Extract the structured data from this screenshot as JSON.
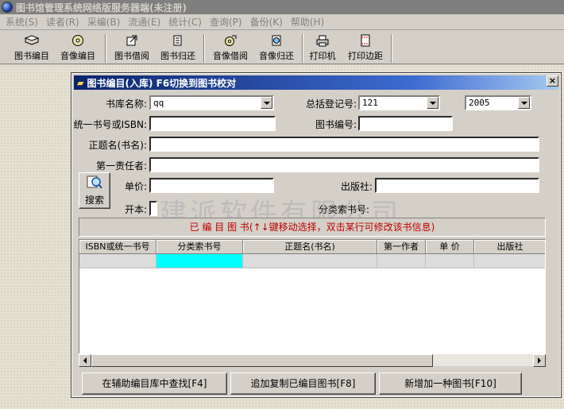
{
  "app": {
    "title": "图书馆管理系统网络版服务器端(未注册)"
  },
  "menu": [
    {
      "label": "系统(S)"
    },
    {
      "label": "读者(R)"
    },
    {
      "label": "采编(B)"
    },
    {
      "label": "流通(E)"
    },
    {
      "label": "统计(C)"
    },
    {
      "label": "查询(P)"
    },
    {
      "label": "备份(K)"
    },
    {
      "label": "帮助(H)"
    }
  ],
  "toolbar": {
    "buttons": [
      {
        "label": "图书编目",
        "icon": "book-icon"
      },
      {
        "label": "音像编目",
        "icon": "disc-icon"
      },
      {
        "label": "图书借阅",
        "icon": "book-borrow-icon"
      },
      {
        "label": "图书归还",
        "icon": "book-return-icon"
      },
      {
        "label": "音像借阅",
        "icon": "disc-borrow-icon"
      },
      {
        "label": "音像归还",
        "icon": "disc-return-icon"
      },
      {
        "label": "打印机",
        "icon": "printer-icon"
      },
      {
        "label": "打印边距",
        "icon": "print-margin-icon"
      }
    ]
  },
  "dialog": {
    "title": "图书编目(入库) F6切换到图书校对",
    "close_label": "×",
    "fields": {
      "library_name": {
        "label": "书库名称:",
        "value": "qq"
      },
      "register_no": {
        "label": "总括登记号:",
        "value": "121"
      },
      "year": {
        "value": "2005"
      },
      "isbn": {
        "label": "统一书号或ISBN:",
        "value": ""
      },
      "book_no": {
        "label": "图书编号:",
        "value": ""
      },
      "title": {
        "label": "正题名(书名):",
        "value": ""
      },
      "author": {
        "label": "第一责任者:",
        "value": ""
      },
      "price": {
        "label": "单价:",
        "value": ""
      },
      "publisher": {
        "label": "出版社:",
        "value": ""
      },
      "format": {
        "label": "开本:"
      },
      "class_no": {
        "label": "分类索书号:"
      }
    },
    "search_label": "搜索",
    "watermark": "建派软件有限公司",
    "banner": "已 编 目 图 书(↑↓键移动选择，双击某行可修改该书信息)",
    "grid": {
      "columns": [
        "ISBN或统一书号",
        "分类索书号",
        "正题名(书名)",
        "第一作者",
        "单 价",
        "出版社"
      ]
    },
    "buttons": {
      "find_aux": "在辅助编目库中查找[F4]",
      "copy_catalogued": "追加复制已编目图书[F8]",
      "add_new": "新增加一种图书[F10]"
    }
  }
}
